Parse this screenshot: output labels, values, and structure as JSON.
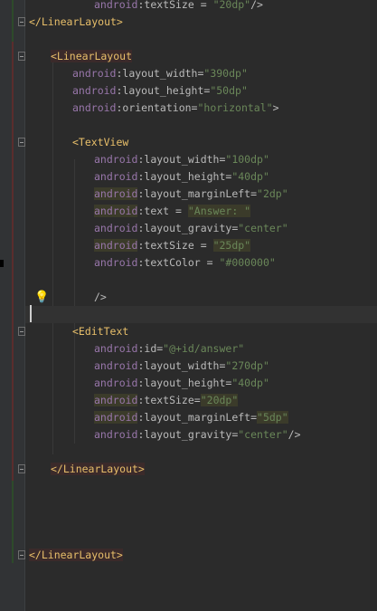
{
  "editor": {
    "lines": [
      {
        "id": "l0",
        "parts": [
          [
            "ns",
            "android"
          ],
          [
            "attr",
            ":textSize = "
          ],
          [
            "val",
            "\"20dp\""
          ],
          [
            "attr",
            "/>"
          ]
        ]
      },
      {
        "id": "l1",
        "parts": [
          [
            "tag",
            "</LinearLayout>"
          ]
        ]
      },
      {
        "id": "l2",
        "parts": []
      },
      {
        "id": "l3",
        "parts": [
          [
            "tag",
            "<LinearLayout"
          ]
        ]
      },
      {
        "id": "l4",
        "parts": [
          [
            "ns",
            "android"
          ],
          [
            "attr",
            ":layout_width="
          ],
          [
            "val",
            "\"390dp\""
          ]
        ]
      },
      {
        "id": "l5",
        "parts": [
          [
            "ns",
            "android"
          ],
          [
            "attr",
            ":layout_height="
          ],
          [
            "val",
            "\"50dp\""
          ]
        ]
      },
      {
        "id": "l6",
        "parts": [
          [
            "ns",
            "android"
          ],
          [
            "attr",
            ":orientation="
          ],
          [
            "val",
            "\"horizontal\""
          ],
          [
            "attr",
            ">"
          ]
        ]
      },
      {
        "id": "l7",
        "parts": []
      },
      {
        "id": "l8",
        "parts": [
          [
            "tag",
            "<TextView"
          ]
        ]
      },
      {
        "id": "l9",
        "parts": [
          [
            "ns",
            "android"
          ],
          [
            "attr",
            ":layout_width="
          ],
          [
            "val",
            "\"100dp\""
          ]
        ]
      },
      {
        "id": "l10",
        "parts": [
          [
            "ns",
            "android"
          ],
          [
            "attr",
            ":layout_height="
          ],
          [
            "val",
            "\"40dp\""
          ]
        ]
      },
      {
        "id": "l11",
        "parts": [
          [
            "ns",
            "android"
          ],
          [
            "attr",
            ":layout_marginLeft="
          ],
          [
            "val",
            "\"2dp\""
          ]
        ]
      },
      {
        "id": "l12",
        "parts": [
          [
            "ns",
            "android"
          ],
          [
            "attr",
            ":text = "
          ],
          [
            "val",
            "\"Answer: \""
          ]
        ]
      },
      {
        "id": "l13",
        "parts": [
          [
            "ns",
            "android"
          ],
          [
            "attr",
            ":layout_gravity="
          ],
          [
            "val",
            "\"center\""
          ]
        ]
      },
      {
        "id": "l14",
        "parts": [
          [
            "ns",
            "android"
          ],
          [
            "attr",
            ":textSize = "
          ],
          [
            "val",
            "\"25dp\""
          ]
        ]
      },
      {
        "id": "l15",
        "parts": [
          [
            "ns",
            "android"
          ],
          [
            "attr",
            ":textColor = "
          ],
          [
            "val",
            "\"#000000\""
          ]
        ]
      },
      {
        "id": "l16",
        "parts": []
      },
      {
        "id": "l17",
        "parts": [
          [
            "attr",
            "/>"
          ]
        ]
      },
      {
        "id": "l18",
        "parts": []
      },
      {
        "id": "l19",
        "parts": [
          [
            "tag",
            "<EditText"
          ]
        ]
      },
      {
        "id": "l20",
        "parts": [
          [
            "ns",
            "android"
          ],
          [
            "attr",
            ":id="
          ],
          [
            "val",
            "\"@+id/answer\""
          ]
        ]
      },
      {
        "id": "l21",
        "parts": [
          [
            "ns",
            "android"
          ],
          [
            "attr",
            ":layout_width="
          ],
          [
            "val",
            "\"270dp\""
          ]
        ]
      },
      {
        "id": "l22",
        "parts": [
          [
            "ns",
            "android"
          ],
          [
            "attr",
            ":layout_height="
          ],
          [
            "val",
            "\"40dp\""
          ]
        ]
      },
      {
        "id": "l23",
        "parts": [
          [
            "ns",
            "android"
          ],
          [
            "attr",
            ":textSize="
          ],
          [
            "val",
            "\"20dp\""
          ]
        ]
      },
      {
        "id": "l24",
        "parts": [
          [
            "ns",
            "android"
          ],
          [
            "attr",
            ":layout_marginLeft="
          ],
          [
            "val",
            "\"5dp\""
          ]
        ]
      },
      {
        "id": "l25",
        "parts": [
          [
            "ns",
            "android"
          ],
          [
            "attr",
            ":layout_gravity="
          ],
          [
            "val",
            "\"center\""
          ],
          [
            "attr",
            "/>"
          ]
        ]
      },
      {
        "id": "l26",
        "parts": []
      },
      {
        "id": "l27",
        "parts": [
          [
            "tag",
            "</LinearLayout>"
          ]
        ]
      },
      {
        "id": "l28",
        "parts": []
      },
      {
        "id": "l29",
        "parts": []
      },
      {
        "id": "l30",
        "parts": []
      },
      {
        "id": "l31",
        "parts": []
      },
      {
        "id": "l32",
        "parts": [
          [
            "tag",
            "</LinearLayout>"
          ]
        ]
      }
    ]
  },
  "icons": {
    "bulb": "lightbulb-icon",
    "fold": "fold-toggle-icon"
  },
  "colors": {
    "background": "#2b2b2b",
    "gutter": "#313335",
    "namespace": "#9876aa",
    "value": "#6a8759",
    "tag": "#e8bf6a",
    "text": "#a9b7c6"
  }
}
